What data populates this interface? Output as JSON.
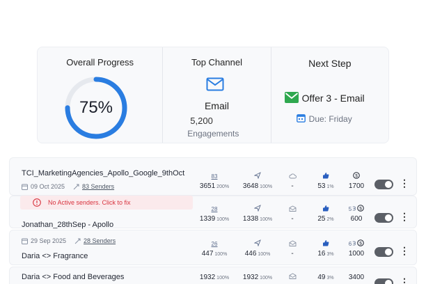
{
  "summary": {
    "progress": {
      "title": "Overall Progress",
      "percent_label": "75%",
      "percent": 75,
      "ring_color": "#2a7de1",
      "track_color": "#e6e9ee"
    },
    "channel": {
      "title": "Top Channel",
      "name": "Email",
      "count": "5,200",
      "count_label": "Engagements",
      "icon": "mail-icon",
      "color": "#2a7de1"
    },
    "next_step": {
      "title": "Next Step",
      "name": "Offer 3 - Email",
      "due": "Due: Friday",
      "icon": "email-green-icon",
      "icon_color": "#2fa84f",
      "calendar_icon": "calendar-icon"
    }
  },
  "campaigns": [
    {
      "name": "TCI_MarketingAgencies_Apollo_Google_9thOct",
      "date": "09 Oct 2025",
      "senders": "83 Senders",
      "stats": {
        "leads": {
          "top": "83",
          "value": "3651",
          "pct": "200%"
        },
        "sent": {
          "value": "3648",
          "pct": "100%"
        },
        "opened": {
          "value": "-"
        },
        "replied": {
          "value": "53",
          "pct": "1%"
        },
        "revenue": {
          "value": "1700"
        }
      },
      "active": true
    },
    {
      "warning": "No Active senders. Click to fix",
      "name": "Jonathan_28thSep - Apollo",
      "stats": {
        "leads": {
          "top": "28",
          "value": "1339",
          "pct": "100%"
        },
        "sent": {
          "value": "1338",
          "pct": "100%"
        },
        "opened": {
          "value": "-"
        },
        "replied": {
          "value": "25",
          "pct": "2%"
        },
        "revenue": {
          "top": "5",
          "value": "600"
        }
      },
      "active": true
    },
    {
      "date": "29 Sep 2025",
      "senders": "28 Senders",
      "name": "Daria <> Fragrance",
      "stats": {
        "leads": {
          "top": "26",
          "value": "447",
          "pct": "100%"
        },
        "sent": {
          "value": "446",
          "pct": "100%"
        },
        "opened": {
          "value": "-"
        },
        "replied": {
          "value": "16",
          "pct": "3%"
        },
        "revenue": {
          "top": "6",
          "value": "1000"
        }
      },
      "active": true
    },
    {
      "name": "Daria <> Food and Beverages",
      "stats": {
        "leads": {
          "value": "1932",
          "pct": "100%"
        },
        "sent": {
          "value": "1932",
          "pct": "100%"
        },
        "opened": {
          "value": "-"
        },
        "replied": {
          "value": "49",
          "pct": "3%"
        },
        "revenue": {
          "value": "3400"
        }
      },
      "active": true
    }
  ],
  "row_menu_glyph": "⋮"
}
